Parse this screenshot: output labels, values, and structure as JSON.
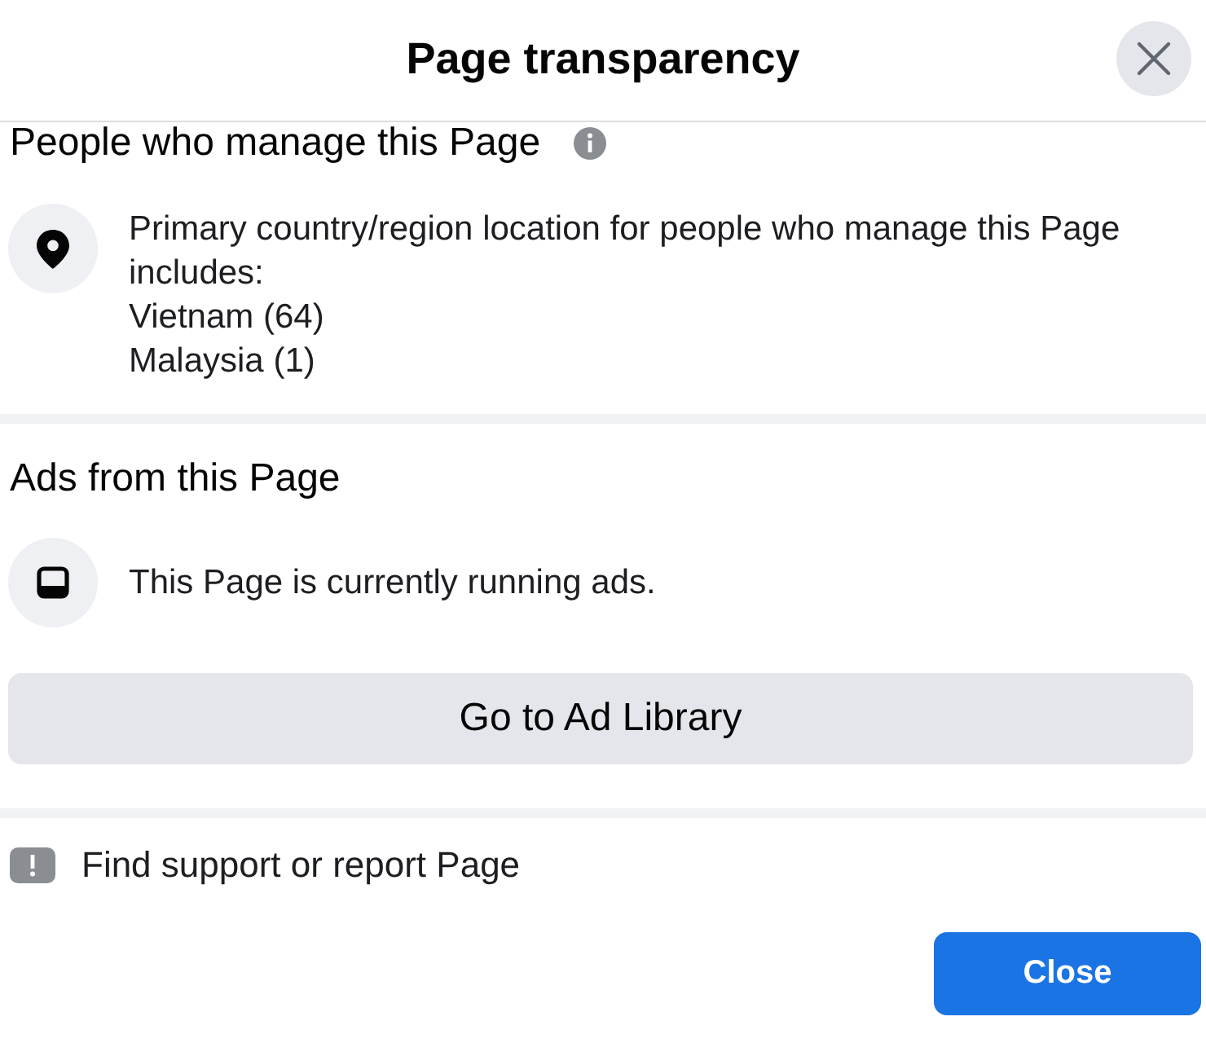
{
  "title": "Page transparency",
  "managers": {
    "heading": "People who manage this Page",
    "description": "Primary country/region location for people who manage this Page includes:",
    "locations": [
      "Vietnam (64)",
      "Malaysia (1)"
    ]
  },
  "ads": {
    "heading": "Ads from this Page",
    "status": "This Page is currently running ads.",
    "button": "Go to Ad Library"
  },
  "support": {
    "label": "Find support or report Page"
  },
  "footer": {
    "button": "Close"
  }
}
